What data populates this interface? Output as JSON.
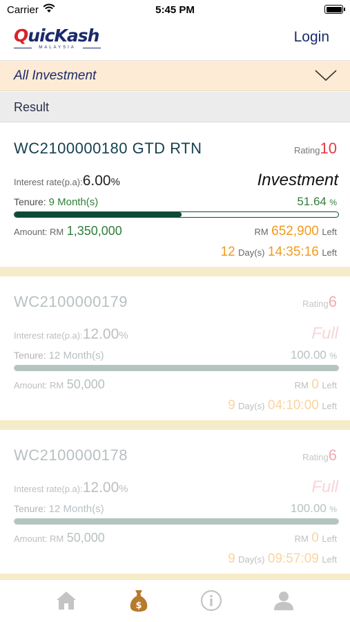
{
  "status_bar": {
    "carrier": "Carrier",
    "time": "5:45 PM"
  },
  "header": {
    "logo": {
      "q": "Q",
      "rest": "uicKash",
      "subtitle": "MALAYSIA"
    },
    "login_label": "Login"
  },
  "filter": {
    "label": "All Investment"
  },
  "result": {
    "label": "Result"
  },
  "cards": [
    {
      "code": "WC2100000180 GTD RTN",
      "rating_label": "Rating",
      "rating_value": "10",
      "interest_label": "Interest rate(p.a):",
      "interest_value": "6.00",
      "interest_unit": "%",
      "status": "Investment",
      "tenure_label": "Tenure:",
      "tenure_value": "9 Month(s)",
      "percent_value": "51.64",
      "percent_unit": "%",
      "progress_percent": 51.64,
      "amount_label": "Amount: RM",
      "amount_value": "1,350,000",
      "left_prefix": "RM",
      "left_value": "652,900",
      "left_suffix": "Left",
      "countdown_days": "12",
      "countdown_days_label": "Day(s)",
      "countdown_time": "14:35:16",
      "countdown_left": "Left",
      "faded": false
    },
    {
      "code": "WC2100000179",
      "rating_label": "Rating",
      "rating_value": "6",
      "interest_label": "Interest rate(p.a):",
      "interest_value": "12.00",
      "interest_unit": "%",
      "status": "Full",
      "tenure_label": "Tenure:",
      "tenure_value": "12 Month(s)",
      "percent_value": "100.00",
      "percent_unit": "%",
      "progress_percent": 100,
      "amount_label": "Amount: RM",
      "amount_value": "50,000",
      "left_prefix": "RM",
      "left_value": "0",
      "left_suffix": "Left",
      "countdown_days": "9",
      "countdown_days_label": "Day(s)",
      "countdown_time": "04:10:00",
      "countdown_left": "Left",
      "faded": true
    },
    {
      "code": "WC2100000178",
      "rating_label": "Rating",
      "rating_value": "6",
      "interest_label": "Interest rate(p.a):",
      "interest_value": "12.00",
      "interest_unit": "%",
      "status": "Full",
      "tenure_label": "Tenure:",
      "tenure_value": "12 Month(s)",
      "percent_value": "100.00",
      "percent_unit": "%",
      "progress_percent": 100,
      "amount_label": "Amount: RM",
      "amount_value": "50,000",
      "left_prefix": "RM",
      "left_value": "0",
      "left_suffix": "Left",
      "countdown_days": "9",
      "countdown_days_label": "Day(s)",
      "countdown_time": "09:57:09",
      "countdown_left": "Left",
      "faded": true
    }
  ],
  "tab_bar": {
    "items": [
      {
        "icon": "home-icon",
        "active": false
      },
      {
        "icon": "money-bag-icon",
        "active": true
      },
      {
        "icon": "info-icon",
        "active": false
      },
      {
        "icon": "profile-icon",
        "active": false
      }
    ]
  },
  "colors": {
    "brand_red": "#d8232a",
    "brand_navy": "#1b2a6b",
    "progress_green": "#0e4a35",
    "value_green": "#2f7d3a",
    "countdown_orange": "#f29a1c",
    "rating_red": "#e53945",
    "filter_bg": "#fdebd6",
    "separator_bg": "#f6ecc9",
    "active_tab": "#b87a2c",
    "inactive_tab": "#c4c4c4"
  }
}
